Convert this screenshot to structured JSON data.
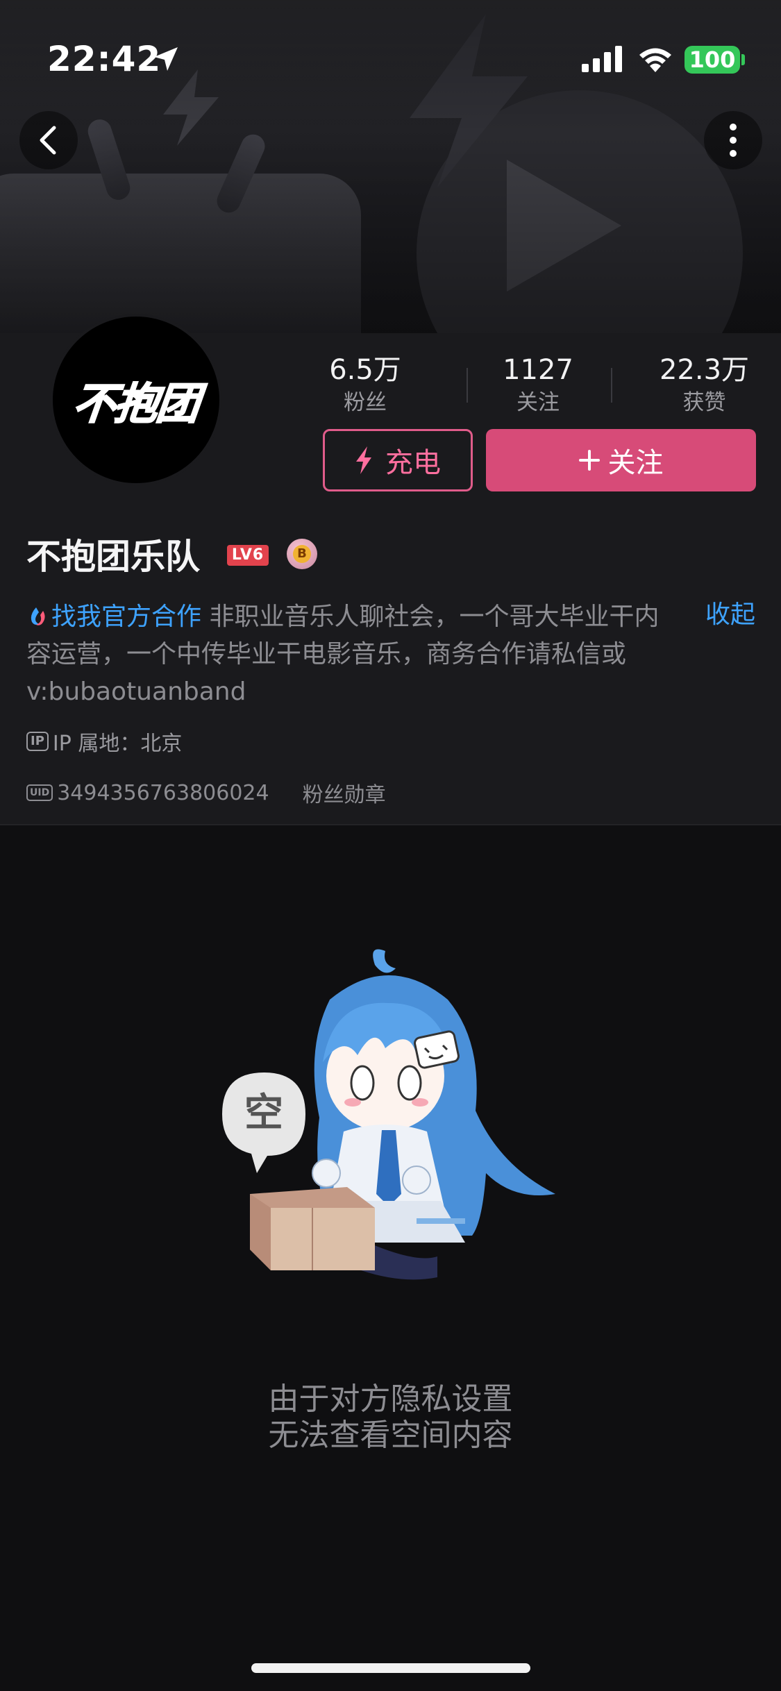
{
  "status_bar": {
    "time": "22:42",
    "battery": "100",
    "battery_color": "#34c759"
  },
  "profile": {
    "avatar_text": "不抱团",
    "stats": [
      {
        "value": "6.5万",
        "label": "粉丝"
      },
      {
        "value": "1127",
        "label": "关注"
      },
      {
        "value": "22.3万",
        "label": "获赞"
      }
    ],
    "charge_label": "充电",
    "follow_label": "关注",
    "name": "不抱团乐队",
    "level_badge": "LV6",
    "medal_letter": "B",
    "bio": {
      "link_text": "找我官方合作",
      "text": " 非职业音乐人聊社会，一个哥大毕业干内容运营，一个中传毕业干电影音乐，商务合作请私信或 v:bubaotuanband"
    },
    "collapse_label": "收起",
    "ip_label": "IP",
    "ip_location": "IP 属地：北京",
    "uid_label": "UID",
    "uid": "3494356763806024",
    "fan_medal": "粉丝勋章"
  },
  "empty_state": {
    "bubble_text": "空",
    "line1": "由于对方隐私设置",
    "line2": "无法查看空间内容"
  },
  "colors": {
    "accent_pink": "#d74b78",
    "link_blue": "#3ea3ff",
    "level_red": "#e2434d"
  }
}
